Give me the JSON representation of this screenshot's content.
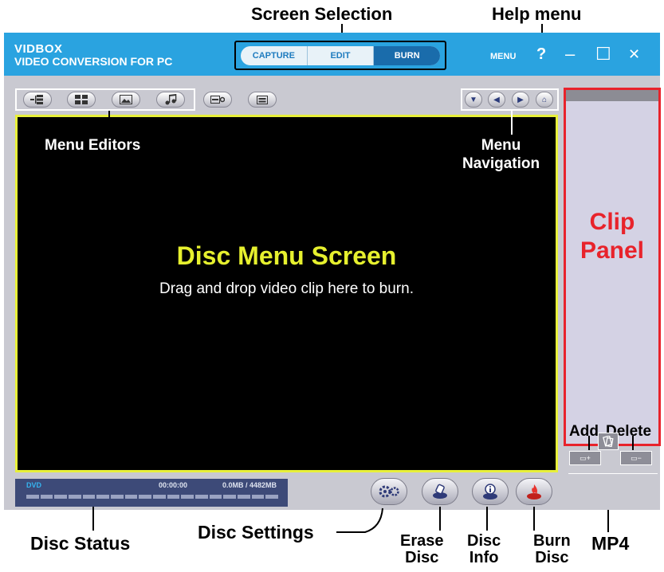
{
  "annotations": {
    "screen_selection": "Screen Selection",
    "help_menu": "Help menu",
    "menu_editors": "Menu Editors",
    "menu_navigation": "Menu\nNavigation",
    "clip_panel": "Clip\nPanel",
    "add": "Add",
    "delete": "Delete",
    "disc_status": "Disc Status",
    "disc_settings": "Disc Settings",
    "erase_disc": "Erase\nDisc",
    "disc_info": "Disc\nInfo",
    "burn_disc": "Burn\nDisc",
    "mp4": "MP4"
  },
  "app": {
    "brand_line1": "VIDBOX",
    "brand_line2": "VIDEO CONVERSION FOR PC",
    "tabs": [
      {
        "label": "CAPTURE",
        "active": false
      },
      {
        "label": "EDIT",
        "active": false
      },
      {
        "label": "BURN",
        "active": true
      }
    ],
    "menu_label": "MENU",
    "help_glyph": "?",
    "minimize_glyph": "–",
    "maximize_glyph": "☐",
    "close_glyph": "✕"
  },
  "disc_menu": {
    "title": "Disc Menu Screen",
    "subtitle": "Drag and drop video clip here to burn."
  },
  "status": {
    "disc_type": "DVD",
    "time": "00:00:00",
    "usage": "0.0MB / 4482MB"
  },
  "icons": {
    "editor_buttons": [
      "tree-icon",
      "layout-icon",
      "picture-icon",
      "music-icon"
    ],
    "extra_buttons": [
      "chapter-settings-icon",
      "menu-preview-icon"
    ],
    "nav_buttons": [
      "down-arrow-icon",
      "left-arrow-icon",
      "right-arrow-icon",
      "home-icon"
    ],
    "round_buttons": [
      "gears-icon",
      "erase-disc-icon",
      "info-icon",
      "burn-icon"
    ]
  },
  "colors": {
    "titlebar": "#2aa3e0",
    "active_tab": "#1a6cab",
    "highlight_yellow": "#e8f03a",
    "clip_panel_red": "#e8232b"
  }
}
